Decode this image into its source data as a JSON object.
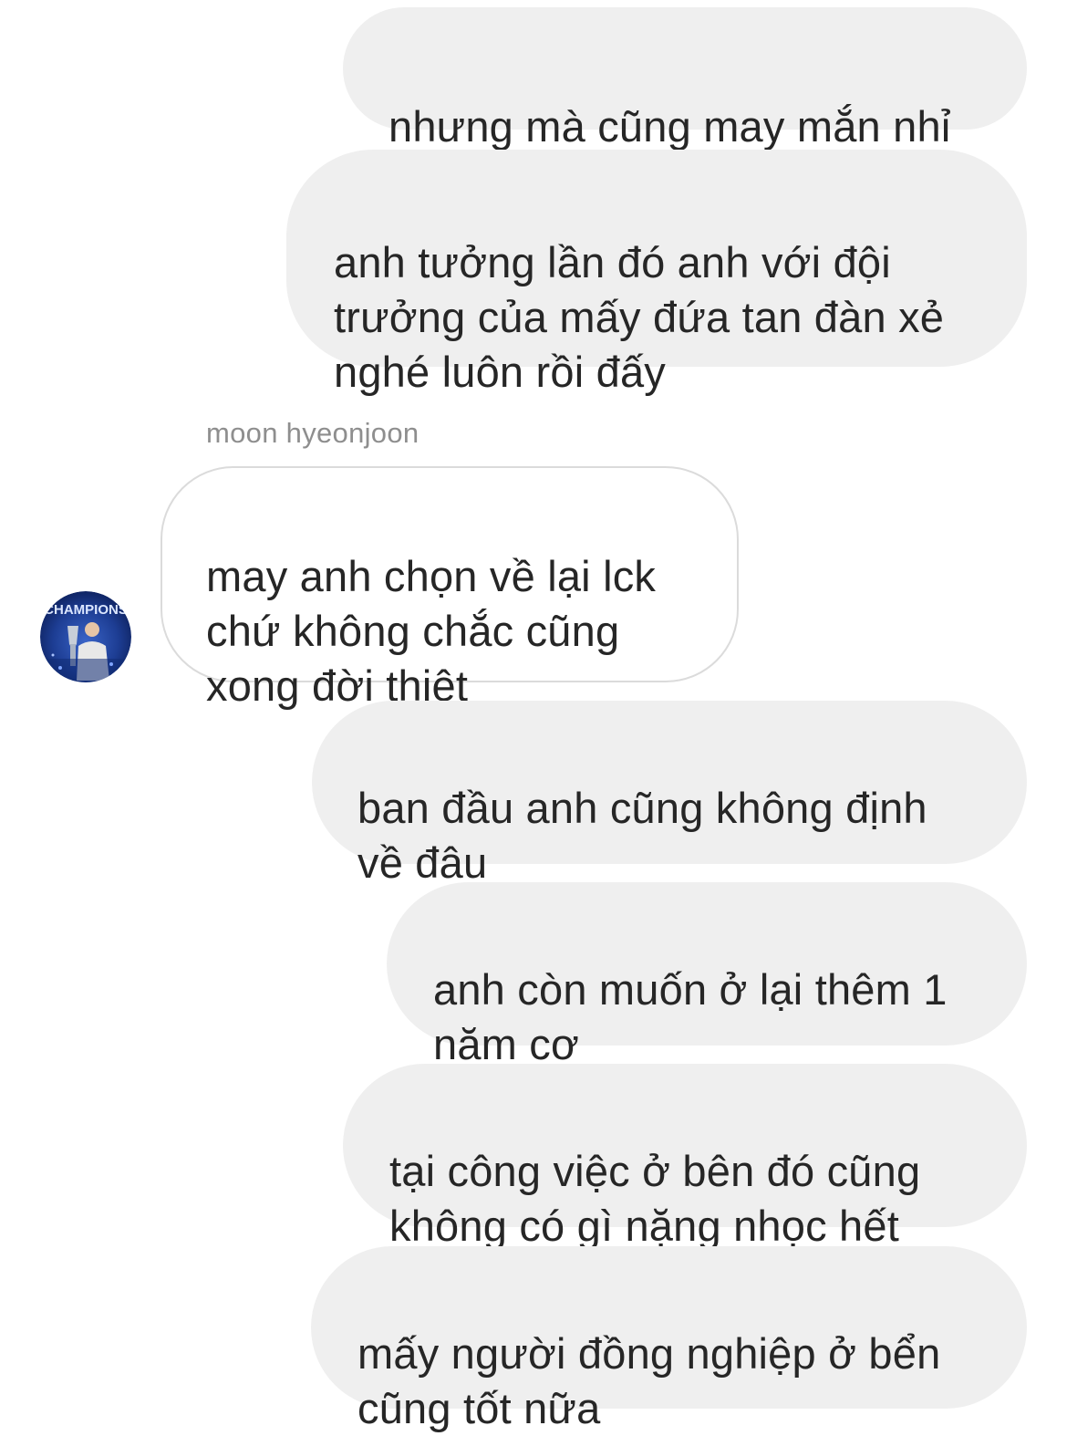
{
  "thread": {
    "sender_name": "moon hyeonjoon",
    "avatar": {
      "icon": "profile-avatar",
      "caption": "CHAMPIONS"
    },
    "messages": [
      {
        "direction": "outgoing",
        "text": "nhưng mà cũng may mắn nhỉ"
      },
      {
        "direction": "outgoing",
        "text": "anh tưởng lần đó anh với đội\ntrưởng của mấy đứa tan đàn xẻ\nnghé luôn rồi đấy"
      },
      {
        "direction": "incoming",
        "text": "may anh chọn về lại lck\nchứ không chắc cũng\nxong đời thiệt"
      },
      {
        "direction": "outgoing",
        "text": "ban đầu anh cũng không định\nvề đâu"
      },
      {
        "direction": "outgoing",
        "text": "anh còn muốn ở lại thêm 1\nnăm cơ"
      },
      {
        "direction": "outgoing",
        "text": "tại công việc ở bên đó  cũng\nkhông có gì nặng nhọc hết"
      },
      {
        "direction": "outgoing",
        "text": "mấy người đồng nghiệp ở bển\ncũng tốt nữa"
      }
    ]
  },
  "colors": {
    "outgoing_bubble": "#efefef",
    "incoming_bubble": "#ffffff",
    "incoming_border": "#dbdbdb",
    "text": "#262626",
    "sender_name": "#8e8e8e"
  }
}
